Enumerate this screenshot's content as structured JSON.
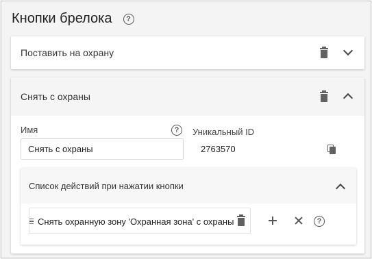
{
  "page": {
    "title": "Кнопки брелока",
    "help_glyph": "?"
  },
  "buttons": [
    {
      "title": "Поставить на охрану",
      "expanded": false
    },
    {
      "title": "Снять с охраны",
      "expanded": true,
      "name_label": "Имя",
      "name_value": "Снять с охраны",
      "uid_label": "Уникальный ID",
      "uid_value": "2763570",
      "actions": {
        "title": "Список действий при нажатии кнопки",
        "items": [
          {
            "text": "Снять охранную зону 'Охранная зона' с охраны"
          }
        ]
      }
    }
  ],
  "icons": {
    "help": "help-circle-icon",
    "delete": "trash-icon",
    "expand": "chevron-down-icon",
    "collapse": "chevron-up-icon",
    "copy": "copy-icon",
    "add": "plus-icon",
    "remove": "close-icon",
    "drag": "drag-handle-icon"
  }
}
